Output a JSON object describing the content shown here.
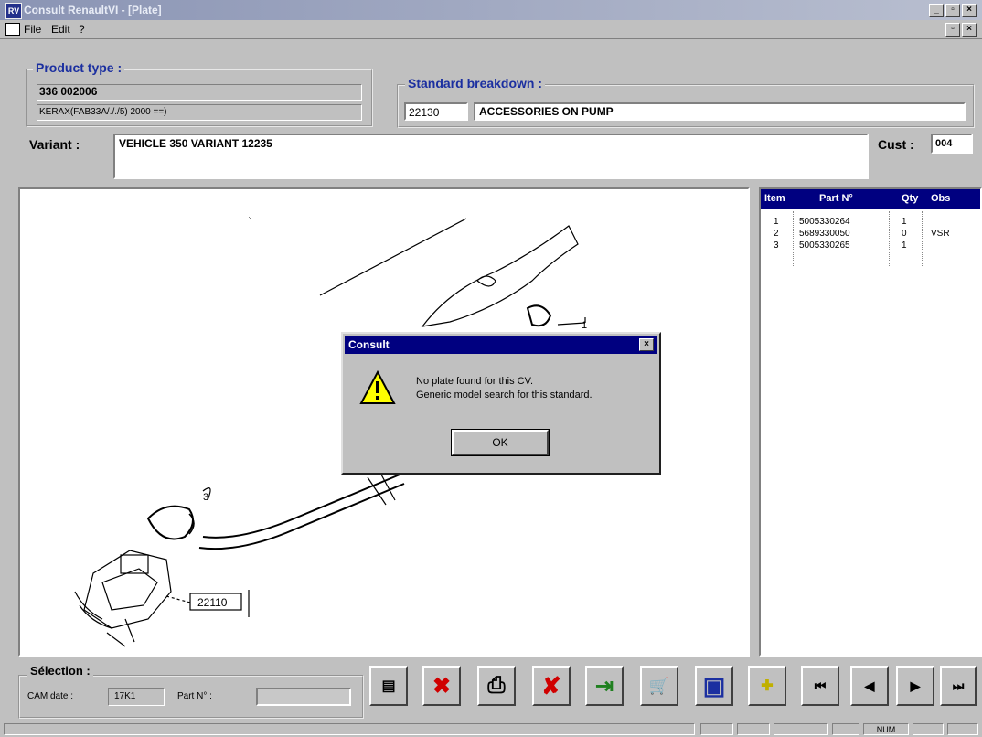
{
  "window": {
    "title": "Consult RenaultVI - [Plate]",
    "app_icon_text": "RV",
    "minimize": "_",
    "maximize": "▫",
    "close": "×",
    "mdi_restore": "▫",
    "mdi_close": "×"
  },
  "menu": {
    "items": [
      {
        "label": "File"
      },
      {
        "label": "Edit"
      },
      {
        "label": "?"
      }
    ]
  },
  "product": {
    "group_label": "Product type :",
    "code": "336 002006",
    "description": "KERAX(FAB33A/././5) 2000 ==)"
  },
  "breakdown": {
    "group_label": "Standard breakdown :",
    "code": "22130",
    "name": "ACCESSORIES ON PUMP"
  },
  "variant": {
    "label": "Variant :",
    "value": "VEHICLE 350 VARIANT 12235"
  },
  "cust": {
    "label": "Cust :",
    "value": "004"
  },
  "drawing": {
    "callout_ref": "22110",
    "callout_num": "3",
    "callout_num2": "1"
  },
  "parts_table": {
    "headers": {
      "item": "Item",
      "part": "Part N°",
      "qty": "Qty",
      "obs": "Obs"
    },
    "rows": [
      {
        "item": "1",
        "part": "5005330264",
        "qty": "1",
        "obs": ""
      },
      {
        "item": "2",
        "part": "5689330050",
        "qty": "0",
        "obs": "VSR"
      },
      {
        "item": "3",
        "part": "5005330265",
        "qty": "1",
        "obs": ""
      }
    ]
  },
  "dialog": {
    "title": "Consult",
    "line1": "No plate found for this CV.",
    "line2": "Generic model search for this standard.",
    "ok_label": "OK",
    "close_label": "×"
  },
  "selection": {
    "group_label": "Sélection :",
    "cam_date_label": "CAM date :",
    "cam_date_value": "17K1",
    "part_label": "Part N° :",
    "part_value": ""
  },
  "toolbar": {
    "buttons": [
      {
        "icon": "list-icon",
        "glyph": "▤"
      },
      {
        "icon": "delete-all-icon",
        "glyph": "✖"
      },
      {
        "icon": "print-icon",
        "glyph": "⎙"
      },
      {
        "icon": "cancel-icon",
        "glyph": "✘"
      },
      {
        "icon": "exit-door-icon",
        "glyph": "⇥"
      },
      {
        "icon": "cart-icon",
        "glyph": "🛒"
      },
      {
        "icon": "display-print-icon",
        "glyph": "▣"
      },
      {
        "icon": "zoom-plus-icon",
        "glyph": "✚"
      },
      {
        "icon": "first-icon",
        "glyph": "⏮"
      },
      {
        "icon": "previous-icon",
        "glyph": "◀"
      },
      {
        "icon": "next-icon",
        "glyph": "▶"
      },
      {
        "icon": "last-icon",
        "glyph": "⏭"
      }
    ]
  },
  "status": {
    "num": "NUM"
  },
  "colors": {
    "accent": "#000080",
    "label_blue": "#1b2fa0",
    "face": "#c0c0c0",
    "red_x": "#d00000",
    "warning": "#ffff00"
  }
}
